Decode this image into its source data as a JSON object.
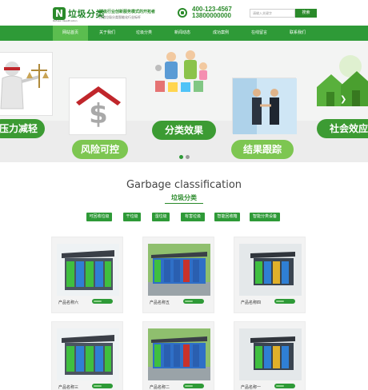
{
  "header": {
    "logo_mark": "N",
    "logo_text": "垃圾分类",
    "logo_sub": "Refuse classification",
    "slogan_1": "垃圾行业创新服务模式的开拓者",
    "slogan_2": "打造垃圾分类智能化行业标杆",
    "phone_1": "400-123-4567",
    "phone_2": "13800000000",
    "search_placeholder": "请输入关键字",
    "search_label": "搜索"
  },
  "nav": {
    "items": [
      {
        "label": "网站首页"
      },
      {
        "label": "关于我们"
      },
      {
        "label": "垃圾分类"
      },
      {
        "label": "新闻动态"
      },
      {
        "label": "成功案例"
      },
      {
        "label": "在线留言"
      },
      {
        "label": "联系我们"
      }
    ]
  },
  "banner": {
    "pill_left": "压力减轻",
    "pill_1": "风险可控",
    "pill_2": "分类效果",
    "pill_3": "结果跟踪",
    "pill_right": "社会效应",
    "money_symbol": "$",
    "prev_arrow": "❮",
    "next_arrow": "❯"
  },
  "section": {
    "title_en": "Garbage classification",
    "title_cn": "垃圾分类"
  },
  "categories": [
    {
      "label": "可回收垃圾"
    },
    {
      "label": "干垃圾"
    },
    {
      "label": "湿垃圾"
    },
    {
      "label": "有害垃圾"
    },
    {
      "label": "智能回收箱"
    },
    {
      "label": "智能分类设备"
    }
  ],
  "products": [
    {
      "name": "产品名称六"
    },
    {
      "name": "产品名称五"
    },
    {
      "name": "产品名称四"
    },
    {
      "name": "产品名称三"
    },
    {
      "name": "产品名称二"
    },
    {
      "name": "产品名称一"
    }
  ],
  "colors": {
    "brand_green": "#2e9a37",
    "light_green": "#7dc651",
    "active_nav": "#5bbd4f"
  }
}
